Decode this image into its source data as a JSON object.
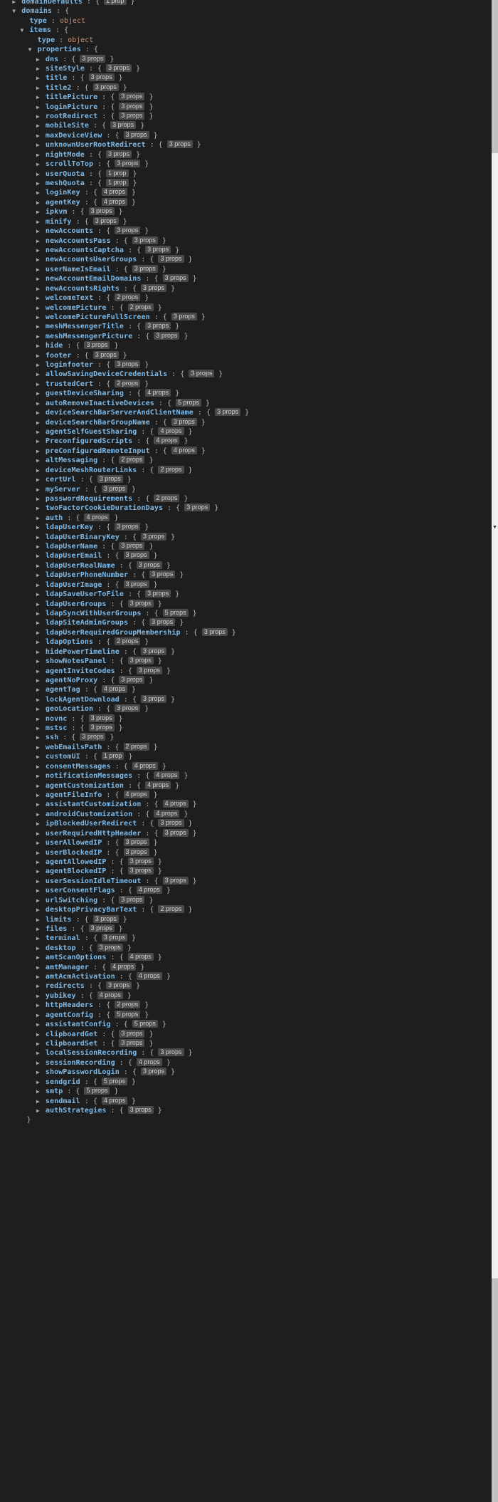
{
  "viewer": {
    "name": "json-tree-viewer",
    "theme": "dark",
    "background_color": "#1e1e1e",
    "key_color": "#7cb9e8",
    "string_value_color": "#ce9178",
    "punctuation_color": "#b8b8b8",
    "badge_bg_color": "#4a4a4a",
    "arrow_expanded": "▼",
    "arrow_collapsed": "▶",
    "colon": ":",
    "brace_open": "{",
    "brace_close": "}"
  },
  "scrollbar": {
    "track_color": "#f1f1f1",
    "thumb_color": "#c1c1c1",
    "marker_glyph": "▼"
  },
  "tree": [
    {
      "indent": 1,
      "state": "collapsed",
      "key": "domainDefaults",
      "badge": "1 prop",
      "clipped": true
    },
    {
      "indent": 1,
      "state": "expanded",
      "key": "domains",
      "open": true
    },
    {
      "indent": 2,
      "state": "none",
      "key": "type",
      "value": "object"
    },
    {
      "indent": 2,
      "state": "expanded",
      "key": "items",
      "open": true
    },
    {
      "indent": 3,
      "state": "none",
      "key": "type",
      "value": "object"
    },
    {
      "indent": 3,
      "state": "expanded",
      "key": "properties",
      "open": true
    },
    {
      "indent": 4,
      "state": "collapsed",
      "key": "dns",
      "badge": "3 props"
    },
    {
      "indent": 4,
      "state": "collapsed",
      "key": "siteStyle",
      "badge": "3 props"
    },
    {
      "indent": 4,
      "state": "collapsed",
      "key": "title",
      "badge": "3 props"
    },
    {
      "indent": 4,
      "state": "collapsed",
      "key": "title2",
      "badge": "3 props"
    },
    {
      "indent": 4,
      "state": "collapsed",
      "key": "titlePicture",
      "badge": "3 props"
    },
    {
      "indent": 4,
      "state": "collapsed",
      "key": "loginPicture",
      "badge": "3 props"
    },
    {
      "indent": 4,
      "state": "collapsed",
      "key": "rootRedirect",
      "badge": "3 props"
    },
    {
      "indent": 4,
      "state": "collapsed",
      "key": "mobileSite",
      "badge": "3 props"
    },
    {
      "indent": 4,
      "state": "collapsed",
      "key": "maxDeviceView",
      "badge": "3 props"
    },
    {
      "indent": 4,
      "state": "collapsed",
      "key": "unknownUserRootRedirect",
      "badge": "3 props"
    },
    {
      "indent": 4,
      "state": "collapsed",
      "key": "nightMode",
      "badge": "3 props"
    },
    {
      "indent": 4,
      "state": "collapsed",
      "key": "scrollToTop",
      "badge": "3 props"
    },
    {
      "indent": 4,
      "state": "collapsed",
      "key": "userQuota",
      "badge": "1 prop"
    },
    {
      "indent": 4,
      "state": "collapsed",
      "key": "meshQuota",
      "badge": "1 prop"
    },
    {
      "indent": 4,
      "state": "collapsed",
      "key": "loginKey",
      "badge": "4 props"
    },
    {
      "indent": 4,
      "state": "collapsed",
      "key": "agentKey",
      "badge": "4 props"
    },
    {
      "indent": 4,
      "state": "collapsed",
      "key": "ipkvm",
      "badge": "3 props"
    },
    {
      "indent": 4,
      "state": "collapsed",
      "key": "minify",
      "badge": "3 props"
    },
    {
      "indent": 4,
      "state": "collapsed",
      "key": "newAccounts",
      "badge": "3 props"
    },
    {
      "indent": 4,
      "state": "collapsed",
      "key": "newAccountsPass",
      "badge": "3 props"
    },
    {
      "indent": 4,
      "state": "collapsed",
      "key": "newAccountsCaptcha",
      "badge": "3 props"
    },
    {
      "indent": 4,
      "state": "collapsed",
      "key": "newAccountsUserGroups",
      "badge": "3 props"
    },
    {
      "indent": 4,
      "state": "collapsed",
      "key": "userNameIsEmail",
      "badge": "3 props"
    },
    {
      "indent": 4,
      "state": "collapsed",
      "key": "newAccountEmailDomains",
      "badge": "3 props"
    },
    {
      "indent": 4,
      "state": "collapsed",
      "key": "newAccountsRights",
      "badge": "3 props"
    },
    {
      "indent": 4,
      "state": "collapsed",
      "key": "welcomeText",
      "badge": "2 props"
    },
    {
      "indent": 4,
      "state": "collapsed",
      "key": "welcomePicture",
      "badge": "2 props"
    },
    {
      "indent": 4,
      "state": "collapsed",
      "key": "welcomePictureFullScreen",
      "badge": "3 props"
    },
    {
      "indent": 4,
      "state": "collapsed",
      "key": "meshMessengerTitle",
      "badge": "3 props"
    },
    {
      "indent": 4,
      "state": "collapsed",
      "key": "meshMessengerPicture",
      "badge": "3 props"
    },
    {
      "indent": 4,
      "state": "collapsed",
      "key": "hide",
      "badge": "3 props"
    },
    {
      "indent": 4,
      "state": "collapsed",
      "key": "footer",
      "badge": "3 props"
    },
    {
      "indent": 4,
      "state": "collapsed",
      "key": "loginfooter",
      "badge": "3 props"
    },
    {
      "indent": 4,
      "state": "collapsed",
      "key": "allowSavingDeviceCredentials",
      "badge": "3 props"
    },
    {
      "indent": 4,
      "state": "collapsed",
      "key": "trustedCert",
      "badge": "2 props"
    },
    {
      "indent": 4,
      "state": "collapsed",
      "key": "guestDeviceSharing",
      "badge": "4 props"
    },
    {
      "indent": 4,
      "state": "collapsed",
      "key": "autoRemoveInactiveDevices",
      "badge": "5 props"
    },
    {
      "indent": 4,
      "state": "collapsed",
      "key": "deviceSearchBarServerAndClientName",
      "badge": "3 props"
    },
    {
      "indent": 4,
      "state": "collapsed",
      "key": "deviceSearchBarGroupName",
      "badge": "3 props"
    },
    {
      "indent": 4,
      "state": "collapsed",
      "key": "agentSelfGuestSharing",
      "badge": "4 props"
    },
    {
      "indent": 4,
      "state": "collapsed",
      "key": "PreconfiguredScripts",
      "badge": "4 props"
    },
    {
      "indent": 4,
      "state": "collapsed",
      "key": "preConfiguredRemoteInput",
      "badge": "4 props"
    },
    {
      "indent": 4,
      "state": "collapsed",
      "key": "altMessaging",
      "badge": "2 props"
    },
    {
      "indent": 4,
      "state": "collapsed",
      "key": "deviceMeshRouterLinks",
      "badge": "2 props"
    },
    {
      "indent": 4,
      "state": "collapsed",
      "key": "certUrl",
      "badge": "3 props"
    },
    {
      "indent": 4,
      "state": "collapsed",
      "key": "myServer",
      "badge": "3 props"
    },
    {
      "indent": 4,
      "state": "collapsed",
      "key": "passwordRequirements",
      "badge": "2 props"
    },
    {
      "indent": 4,
      "state": "collapsed",
      "key": "twoFactorCookieDurationDays",
      "badge": "3 props"
    },
    {
      "indent": 4,
      "state": "collapsed",
      "key": "auth",
      "badge": "4 props"
    },
    {
      "indent": 4,
      "state": "collapsed",
      "key": "ldapUserKey",
      "badge": "3 props"
    },
    {
      "indent": 4,
      "state": "collapsed",
      "key": "ldapUserBinaryKey",
      "badge": "3 props"
    },
    {
      "indent": 4,
      "state": "collapsed",
      "key": "ldapUserName",
      "badge": "3 props"
    },
    {
      "indent": 4,
      "state": "collapsed",
      "key": "ldapUserEmail",
      "badge": "3 props"
    },
    {
      "indent": 4,
      "state": "collapsed",
      "key": "ldapUserRealName",
      "badge": "3 props"
    },
    {
      "indent": 4,
      "state": "collapsed",
      "key": "ldapUserPhoneNumber",
      "badge": "3 props"
    },
    {
      "indent": 4,
      "state": "collapsed",
      "key": "ldapUserImage",
      "badge": "3 props"
    },
    {
      "indent": 4,
      "state": "collapsed",
      "key": "ldapSaveUserToFile",
      "badge": "3 props"
    },
    {
      "indent": 4,
      "state": "collapsed",
      "key": "ldapUserGroups",
      "badge": "3 props"
    },
    {
      "indent": 4,
      "state": "collapsed",
      "key": "ldapSyncWithUserGroups",
      "badge": "5 props"
    },
    {
      "indent": 4,
      "state": "collapsed",
      "key": "ldapSiteAdminGroups",
      "badge": "3 props"
    },
    {
      "indent": 4,
      "state": "collapsed",
      "key": "ldapUserRequiredGroupMembership",
      "badge": "3 props"
    },
    {
      "indent": 4,
      "state": "collapsed",
      "key": "ldapOptions",
      "badge": "2 props"
    },
    {
      "indent": 4,
      "state": "collapsed",
      "key": "hidePowerTimeline",
      "badge": "3 props"
    },
    {
      "indent": 4,
      "state": "collapsed",
      "key": "showNotesPanel",
      "badge": "3 props"
    },
    {
      "indent": 4,
      "state": "collapsed",
      "key": "agentInviteCodes",
      "badge": "3 props"
    },
    {
      "indent": 4,
      "state": "collapsed",
      "key": "agentNoProxy",
      "badge": "3 props"
    },
    {
      "indent": 4,
      "state": "collapsed",
      "key": "agentTag",
      "badge": "4 props"
    },
    {
      "indent": 4,
      "state": "collapsed",
      "key": "lockAgentDownload",
      "badge": "3 props"
    },
    {
      "indent": 4,
      "state": "collapsed",
      "key": "geoLocation",
      "badge": "3 props"
    },
    {
      "indent": 4,
      "state": "collapsed",
      "key": "novnc",
      "badge": "3 props"
    },
    {
      "indent": 4,
      "state": "collapsed",
      "key": "mstsc",
      "badge": "3 props"
    },
    {
      "indent": 4,
      "state": "collapsed",
      "key": "ssh",
      "badge": "3 props"
    },
    {
      "indent": 4,
      "state": "collapsed",
      "key": "webEmailsPath",
      "badge": "2 props"
    },
    {
      "indent": 4,
      "state": "collapsed",
      "key": "customUI",
      "badge": "1 prop"
    },
    {
      "indent": 4,
      "state": "collapsed",
      "key": "consentMessages",
      "badge": "4 props"
    },
    {
      "indent": 4,
      "state": "collapsed",
      "key": "notificationMessages",
      "badge": "4 props"
    },
    {
      "indent": 4,
      "state": "collapsed",
      "key": "agentCustomization",
      "badge": "4 props"
    },
    {
      "indent": 4,
      "state": "collapsed",
      "key": "agentFileInfo",
      "badge": "4 props"
    },
    {
      "indent": 4,
      "state": "collapsed",
      "key": "assistantCustomization",
      "badge": "4 props"
    },
    {
      "indent": 4,
      "state": "collapsed",
      "key": "androidCustomization",
      "badge": "4 props"
    },
    {
      "indent": 4,
      "state": "collapsed",
      "key": "ipBlockedUserRedirect",
      "badge": "3 props"
    },
    {
      "indent": 4,
      "state": "collapsed",
      "key": "userRequiredHttpHeader",
      "badge": "3 props"
    },
    {
      "indent": 4,
      "state": "collapsed",
      "key": "userAllowedIP",
      "badge": "3 props"
    },
    {
      "indent": 4,
      "state": "collapsed",
      "key": "userBlockedIP",
      "badge": "3 props"
    },
    {
      "indent": 4,
      "state": "collapsed",
      "key": "agentAllowedIP",
      "badge": "3 props"
    },
    {
      "indent": 4,
      "state": "collapsed",
      "key": "agentBlockedIP",
      "badge": "3 props"
    },
    {
      "indent": 4,
      "state": "collapsed",
      "key": "userSessionIdleTimeout",
      "badge": "3 props"
    },
    {
      "indent": 4,
      "state": "collapsed",
      "key": "userConsentFlags",
      "badge": "4 props"
    },
    {
      "indent": 4,
      "state": "collapsed",
      "key": "urlSwitching",
      "badge": "3 props"
    },
    {
      "indent": 4,
      "state": "collapsed",
      "key": "desktopPrivacyBarText",
      "badge": "2 props"
    },
    {
      "indent": 4,
      "state": "collapsed",
      "key": "limits",
      "badge": "3 props"
    },
    {
      "indent": 4,
      "state": "collapsed",
      "key": "files",
      "badge": "3 props"
    },
    {
      "indent": 4,
      "state": "collapsed",
      "key": "terminal",
      "badge": "3 props"
    },
    {
      "indent": 4,
      "state": "collapsed",
      "key": "desktop",
      "badge": "3 props"
    },
    {
      "indent": 4,
      "state": "collapsed",
      "key": "amtScanOptions",
      "badge": "4 props"
    },
    {
      "indent": 4,
      "state": "collapsed",
      "key": "amtManager",
      "badge": "4 props"
    },
    {
      "indent": 4,
      "state": "collapsed",
      "key": "amtAcmActivation",
      "badge": "4 props"
    },
    {
      "indent": 4,
      "state": "collapsed",
      "key": "redirects",
      "badge": "3 props"
    },
    {
      "indent": 4,
      "state": "collapsed",
      "key": "yubikey",
      "badge": "4 props"
    },
    {
      "indent": 4,
      "state": "collapsed",
      "key": "httpHeaders",
      "badge": "2 props"
    },
    {
      "indent": 4,
      "state": "collapsed",
      "key": "agentConfig",
      "badge": "5 props"
    },
    {
      "indent": 4,
      "state": "collapsed",
      "key": "assistantConfig",
      "badge": "5 props"
    },
    {
      "indent": 4,
      "state": "collapsed",
      "key": "clipboardGet",
      "badge": "3 props"
    },
    {
      "indent": 4,
      "state": "collapsed",
      "key": "clipboardSet",
      "badge": "3 props"
    },
    {
      "indent": 4,
      "state": "collapsed",
      "key": "localSessionRecording",
      "badge": "3 props"
    },
    {
      "indent": 4,
      "state": "collapsed",
      "key": "sessionRecording",
      "badge": "4 props"
    },
    {
      "indent": 4,
      "state": "collapsed",
      "key": "showPasswordLogin",
      "badge": "3 props"
    },
    {
      "indent": 4,
      "state": "collapsed",
      "key": "sendgrid",
      "badge": "5 props"
    },
    {
      "indent": 4,
      "state": "collapsed",
      "key": "smtp",
      "badge": "5 props"
    },
    {
      "indent": 4,
      "state": "collapsed",
      "key": "sendmail",
      "badge": "4 props"
    },
    {
      "indent": 4,
      "state": "collapsed",
      "key": "authStrategies",
      "badge": "3 props"
    },
    {
      "indent": 3,
      "state": "none",
      "closing": "}"
    }
  ]
}
